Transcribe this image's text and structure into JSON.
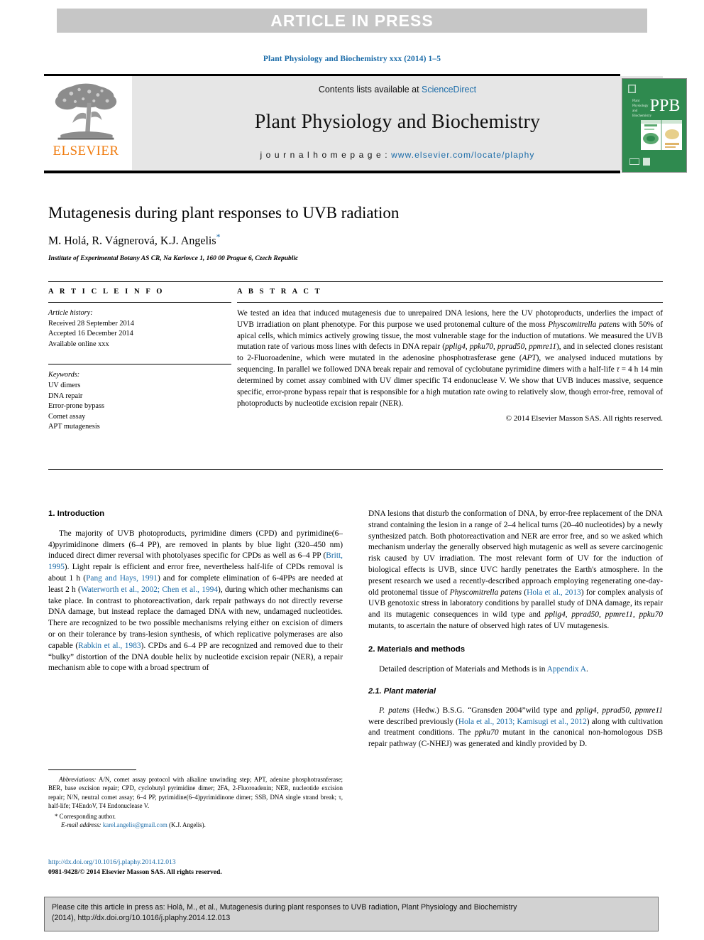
{
  "banner": {
    "text": "ARTICLE IN PRESS"
  },
  "running_head": "Plant Physiology and Biochemistry xxx (2014) 1–5",
  "masthead": {
    "contents_prefix": "Contents lists available at ",
    "sciencedirect": "ScienceDirect",
    "journal_title": "Plant Physiology and Biochemistry",
    "homepage_prefix": "j o u r n a l   h o m e p a g e :  ",
    "homepage_url": "www.elsevier.com/locate/plaphy",
    "publisher_name": "ELSEVIER",
    "cover_acronym": "PPB",
    "cover_subtitle": "Plant Physiology and Biochemistry",
    "colors": {
      "link": "#1a6ba8",
      "elsevier_orange": "#f07c10",
      "cover_green": "#2f8a4f",
      "banner_grey": "#c6c6c6"
    }
  },
  "article": {
    "title": "Mutagenesis during plant responses to UVB radiation",
    "authors": "M. Holá, R. Vágnerová, K.J. Angelis",
    "corresponding_marker": "*",
    "affiliation": "Institute of Experimental Botany AS CR, Na Karlovce 1, 160 00 Prague 6, Czech Republic"
  },
  "article_info": {
    "label": "A R T I C L E   I N F O",
    "history_head": "Article history:",
    "history": [
      "Received 28 September 2014",
      "Accepted 16 December 2014",
      "Available online xxx"
    ],
    "keywords_head": "Keywords:",
    "keywords": [
      "UV dimers",
      "DNA repair",
      "Error-prone bypass",
      "Comet assay",
      "APT mutagenesis"
    ]
  },
  "abstract": {
    "label": "A B S T R A C T",
    "p1_a": "We tested an idea that induced mutagenesis due to unrepaired DNA lesions, here the UV photoproducts, underlies the impact of UVB irradiation on plant phenotype. For this purpose we used protonemal culture of the moss ",
    "p1_i1": "Physcomitrella patens",
    "p1_b": " with 50% of apical cells, which mimics actively growing tissue, the most vulnerable stage for the induction of mutations. We measured the UVB mutation rate of various moss lines with defects in DNA repair (",
    "p1_i2": "pplig4, ppku70, pprad50, ppmre11",
    "p1_c": "), and in selected clones resistant to 2-Fluoroadenine, which were mutated in the adenosine phosphotrasferase gene (",
    "p1_i3": "APT",
    "p1_d": "), we analysed induced mutations by sequencing. In parallel we followed DNA break repair and removal of cyclobutane pyrimidine dimers with a half-life ",
    "p1_i4": "τ",
    "p1_e": " = 4 h 14 min determined by comet assay combined with UV dimer specific T4 endonuclease V. We show that UVB induces massive, sequence specific, error-prone bypass repair that is responsible for a high mutation rate owing to relatively slow, though error-free, removal of photoproducts by nucleotide excision repair (NER).",
    "copyright": "© 2014 Elsevier Masson SAS. All rights reserved."
  },
  "body": {
    "left": {
      "intro_head": "1.  Introduction",
      "p1_a": "The majority of UVB photoproducts, pyrimidine dimers (CPD) and pyrimidine(6–4)pyrimidinone dimers (6–4 PP), are removed in plants by blue light (320–450 nm) induced direct dimer reversal with photolyases specific for CPDs as well as 6–4 PP (",
      "ref1": "Britt, 1995",
      "p1_b": "). Light repair is efficient and error free, nevertheless half-life of CPDs removal is about 1 h (",
      "ref2": "Pang and Hays, 1991",
      "p1_c": ") and for complete elimination of 6-4PPs are needed at least 2 h (",
      "ref3": "Waterworth et al., 2002; Chen et al., 1994",
      "p1_d": "), during which other mechanisms can take place. In contrast to photoreactivation, dark repair pathways do not directly reverse DNA damage, but instead replace the damaged DNA with new, undamaged nucleotides. There are recognized to be two possible mechanisms relying either on excision of dimers or on their tolerance by trans-lesion synthesis, of which replicative polymerases are also capable (",
      "ref4": "Rabkin et al., 1983",
      "p1_e": "). CPDs and 6–4 PP are recognized and removed due to their “bulky” distortion of the DNA double helix by nucleotide excision repair (NER), a repair mechanism able to cope with a broad spectrum of"
    },
    "right": {
      "p1_a": "DNA lesions that disturb the conformation of DNA, by error-free replacement of the DNA strand containing the lesion in a range of 2–4 helical turns (20–40 nucleotides) by a newly synthesized patch. Both photoreactivation and NER are error free, and so we asked which mechanism underlay the generally observed high mutagenic as well as severe carcinogenic risk caused by UV irradiation. The most relevant form of UV for the induction of biological effects is UVB, since UVC hardly penetrates the Earth's atmosphere. In the present research we used a recently-described approach employing regenerating one-day-old protonemal tissue of ",
      "p1_i1": "Physcomitrella patens",
      "p1_b": " (",
      "ref1": "Hola et al., 2013",
      "p1_c": ") for complex analysis of UVB genotoxic stress in laboratory conditions by parallel study of DNA damage, its repair and its mutagenic consequences in wild type and ",
      "p1_i2": "pplig4, pprad50, ppmre11, ppku70",
      "p1_d": " mutants, to ascertain the nature of observed high rates of UV mutagenesis.",
      "methods_head": "2.  Materials and methods",
      "p2_a": "Detailed description of Materials and Methods is in ",
      "appendix_link": "Appendix A",
      "p2_b": ".",
      "subsec_head": "2.1.  Plant material",
      "p3_i1": "P. patens",
      "p3_a": " (Hedw.) B.S.G. “Gransden 2004”wild type and ",
      "p3_i2": "pplig4, pprad50, ppmre11",
      "p3_b": " were described previously (",
      "ref2": "Hola et al., 2013; Kamisugi et al., 2012",
      "p3_c": ") along with cultivation and treatment conditions. The ",
      "p3_i3": "ppku70",
      "p3_d": " mutant in the canonical non-homologous DSB repair pathway (C-NHEJ) was generated and kindly provided by D."
    }
  },
  "footnotes": {
    "abbr_head": "Abbreviations:",
    "abbr_text": " A/N, comet assay protocol with alkaline unwinding step; APT, adenine phosphotrasnferase; BER, base excision repair; CPD, cyclobutyl pyrimidine dimer; 2FA, 2-Fluoroadenin; NER, nucleotide excision repair; N/N, neutral comet assay; 6–4 PP, pyrimidine(6–4)pyrimidinone dimer; SSB, DNA single strand break; τ, half-life; T4EndoV, T4 Endonuclease V.",
    "corresponding": "* Corresponding author.",
    "email_label": "E-mail address:",
    "email": "karel.angelis@gmail.com",
    "email_suffix": " (K.J. Angelis)."
  },
  "doi_block": {
    "doi_url": "http://dx.doi.org/10.1016/j.plaphy.2014.12.013",
    "issn_line": "0981-9428/© 2014 Elsevier Masson SAS. All rights reserved."
  },
  "cite_box": {
    "line1": "Please cite this article in press as: Holá, M., et al., Mutagenesis during plant responses to UVB radiation, Plant Physiology and Biochemistry",
    "line2": "(2014), http://dx.doi.org/10.1016/j.plaphy.2014.12.013"
  }
}
